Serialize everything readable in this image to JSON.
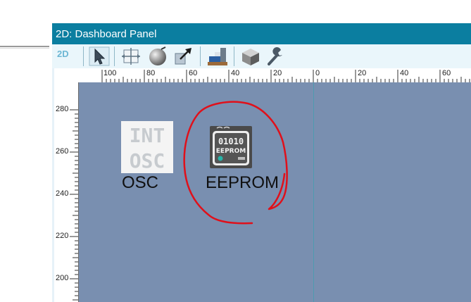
{
  "window": {
    "title": "2D: Dashboard Panel"
  },
  "toolbar": {
    "mode_label": "2D",
    "buttons": [
      {
        "name": "select-arrow-icon"
      },
      {
        "name": "resize-box-icon"
      },
      {
        "name": "sphere-icon"
      },
      {
        "name": "move-arrow-icon"
      },
      {
        "name": "stairs-icon"
      },
      {
        "name": "cube-icon"
      },
      {
        "name": "wrench-icon"
      }
    ]
  },
  "ruler_top": [
    "100",
    "80",
    "60",
    "40",
    "20",
    "0",
    "20",
    "40",
    "60"
  ],
  "ruler_left": [
    "280",
    "260",
    "240",
    "220",
    "200"
  ],
  "components": [
    {
      "name": "OSC",
      "icon_lines": [
        "INT",
        "OSC"
      ]
    },
    {
      "name": "EEPROM",
      "icon_lines": [
        "01010",
        "EEPROM"
      ]
    }
  ],
  "colors": {
    "titlebar": "#0b7ea0",
    "canvas": "#798fb0",
    "annotation": "#e0101a"
  }
}
